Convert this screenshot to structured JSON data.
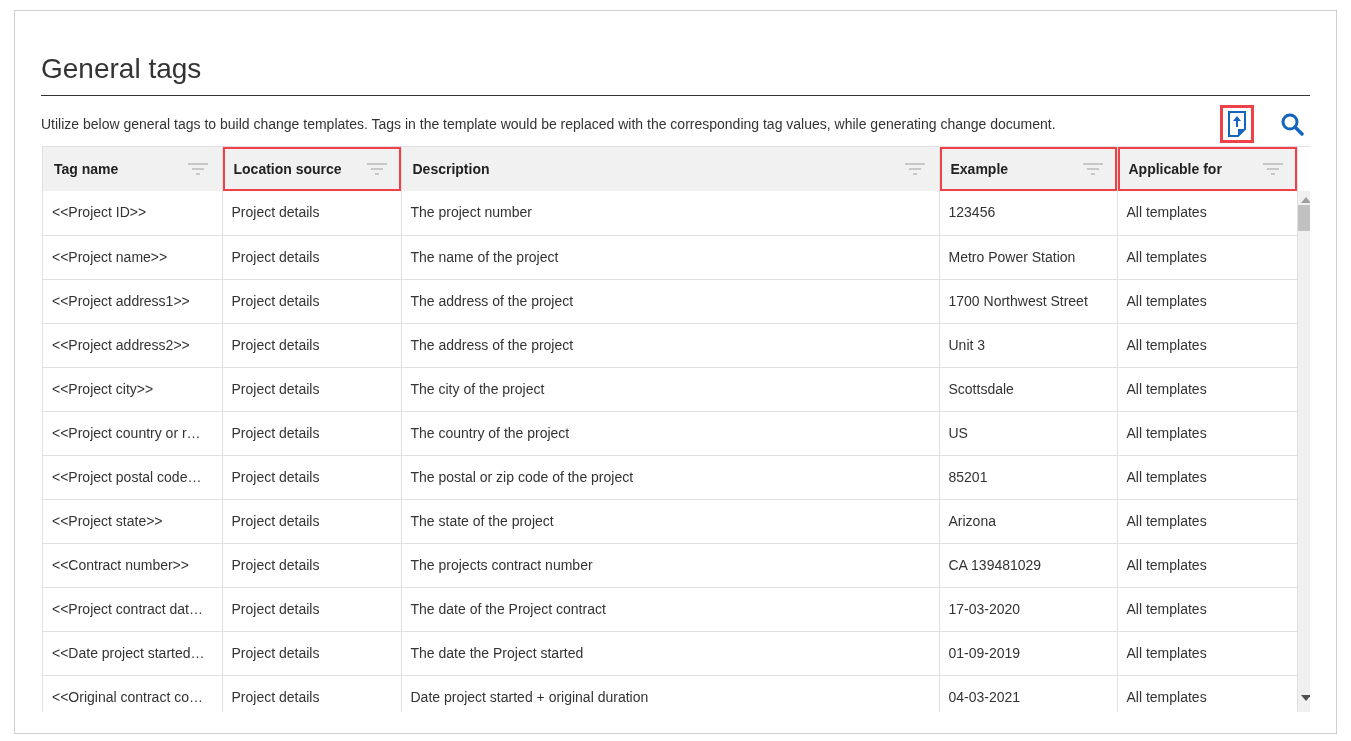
{
  "title": "General tags",
  "description": "Utilize below general tags to build change templates. Tags in the template would be replaced with the corresponding tag values, while generating change document.",
  "toolbar": {
    "export_highlighted": true
  },
  "table": {
    "columns": [
      {
        "label": "Tag name",
        "highlighted": false
      },
      {
        "label": "Location source",
        "highlighted": true
      },
      {
        "label": "Description",
        "highlighted": false
      },
      {
        "label": "Example",
        "highlighted": true
      },
      {
        "label": "Applicable for",
        "highlighted": true
      }
    ],
    "rows": [
      [
        "<<Project ID>>",
        "Project details",
        "The project number",
        "123456",
        "All templates"
      ],
      [
        "<<Project name>>",
        "Project details",
        "The name of the project",
        "Metro Power Station",
        "All templates"
      ],
      [
        "<<Project address1>>",
        "Project details",
        "The address of the project",
        "1700 Northwest Street",
        "All templates"
      ],
      [
        "<<Project address2>>",
        "Project details",
        "The address of the project",
        "Unit 3",
        "All templates"
      ],
      [
        "<<Project city>>",
        "Project details",
        "The city of the project",
        "Scottsdale",
        "All templates"
      ],
      [
        "<<Project country or r…",
        "Project details",
        "The country of the project",
        "US",
        "All templates"
      ],
      [
        "<<Project postal code…",
        "Project details",
        "The postal or zip code of the project",
        "85201",
        "All templates"
      ],
      [
        "<<Project state>>",
        "Project details",
        "The state of the project",
        "Arizona",
        "All templates"
      ],
      [
        "<<Contract number>>",
        "Project details",
        "The projects contract number",
        "CA 139481029",
        "All templates"
      ],
      [
        "<<Project contract dat…",
        "Project details",
        "The date of the Project contract",
        "17-03-2020",
        "All templates"
      ],
      [
        "<<Date project started…",
        "Project details",
        "The date the Project started",
        "01-09-2019",
        "All templates"
      ],
      [
        "<<Original contract co…",
        "Project details",
        "Date project started + original duration",
        "04-03-2021",
        "All templates"
      ]
    ]
  }
}
